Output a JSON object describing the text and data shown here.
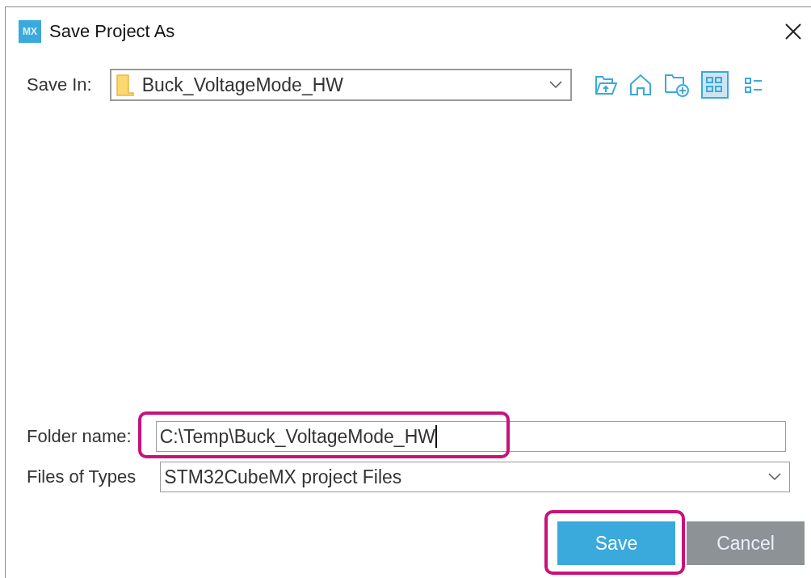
{
  "window": {
    "title": "Save Project As",
    "logo": "MX"
  },
  "save_in": {
    "label": "Save In:",
    "value": "Buck_VoltageMode_HW"
  },
  "view_buttons": [
    {
      "kind": "grid",
      "selected": true
    },
    {
      "kind": "list",
      "selected": false
    }
  ],
  "folder_name": {
    "label": "Folder name:",
    "value": "C:\\Temp\\Buck_VoltageMode_HW",
    "highlighted": true
  },
  "file_type": {
    "label": "Files of Types",
    "value": "STM32CubeMX project Files"
  },
  "buttons": [
    {
      "label": "Save",
      "kind": "primary",
      "highlighted": true
    },
    {
      "label": "Cancel",
      "kind": "secondary",
      "highlighted": false
    }
  ]
}
